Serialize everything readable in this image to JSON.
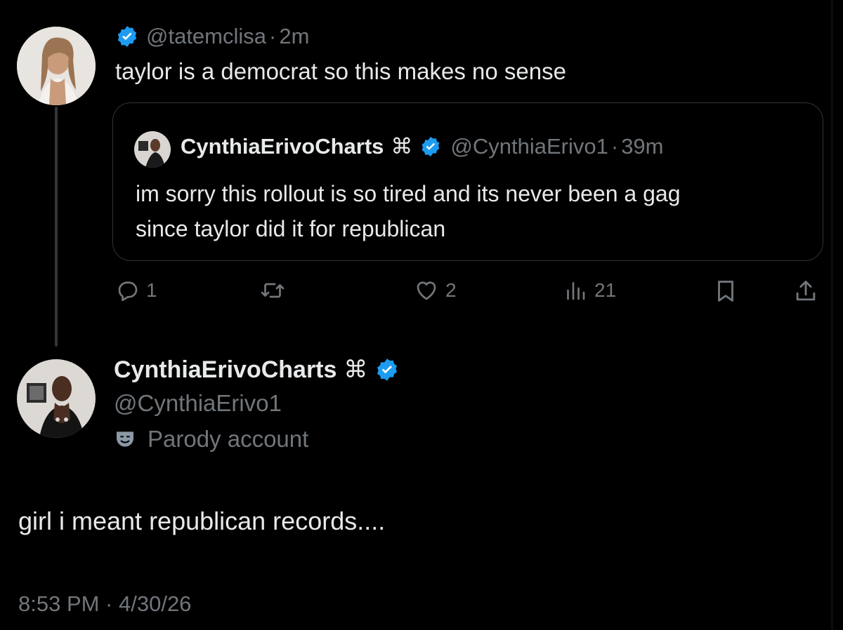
{
  "reply_tweet": {
    "handle": "@tatemclisa",
    "time": "2m",
    "text": "taylor is a democrat so this makes no sense"
  },
  "quoted_tweet": {
    "display_name": "CynthiaErivoCharts",
    "name_symbol": "⌘",
    "handle": "@CynthiaErivo1",
    "time": "39m",
    "text_line1": "im sorry this rollout is so tired and its never been a gag",
    "text_line2": "since taylor did it for republican"
  },
  "actions": {
    "replies": "1",
    "likes": "2",
    "views": "21"
  },
  "main_tweet": {
    "display_name": "CynthiaErivoCharts",
    "name_symbol": "⌘",
    "handle": "@CynthiaErivo1",
    "label": "Parody account",
    "text": "girl i meant republican records....",
    "timestamp": "8:53 PM · 4/30/26"
  },
  "icons": {
    "verified": "verified-badge-icon",
    "reply": "reply-icon",
    "repost": "repost-icon",
    "like": "heart-icon",
    "views": "views-icon",
    "bookmark": "bookmark-icon",
    "share": "share-icon",
    "parody": "mask-icon"
  },
  "colors": {
    "background": "#000000",
    "text": "#e7e9ea",
    "muted": "#71767b",
    "verified": "#1d9bf0",
    "border": "#2f3336"
  }
}
